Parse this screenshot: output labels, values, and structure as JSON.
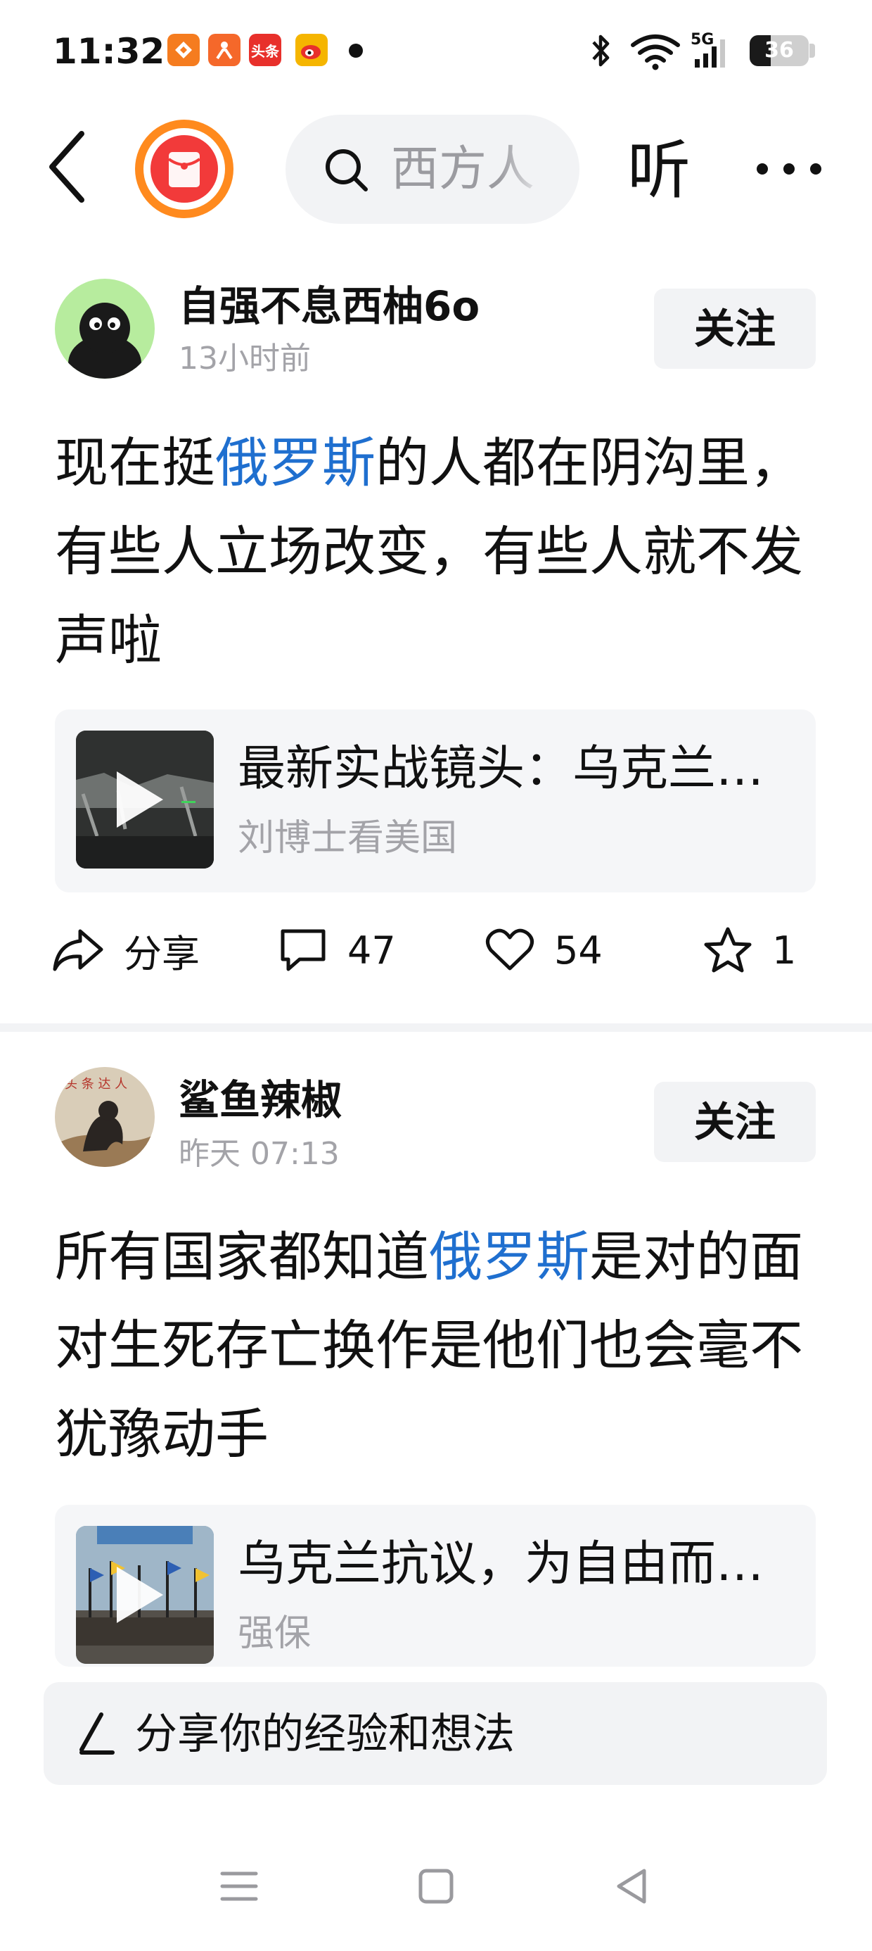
{
  "status_bar": {
    "time": "11:32",
    "app_icons": [
      {
        "name": "app-icon-1",
        "color": "#f57c1f"
      },
      {
        "name": "app-icon-2",
        "color": "#f5682a"
      },
      {
        "name": "toutiao-icon",
        "label": "头条",
        "color": "#e8302b"
      },
      {
        "name": "weibo-icon",
        "color": "#f5b500"
      }
    ],
    "network": "5G",
    "battery": "36",
    "battery_level": 0.36
  },
  "top_bar": {
    "search_placeholder": "西方人",
    "listen_label": "听"
  },
  "posts": [
    {
      "author": "自强不息西柚6o",
      "time": "13小时前",
      "follow_label": "关注",
      "text_before": "现在挺",
      "text_highlight": "俄罗斯",
      "text_after": "的人都在阴沟里，有些人立场改变，有些人就不发声啦",
      "card_title": "最新实战镜头：乌克兰…",
      "card_source": "刘博士看美国",
      "share_label": "分享",
      "comments": "47",
      "likes": "54",
      "favorites": "1"
    },
    {
      "author": "鲨鱼辣椒",
      "time": "昨天  07:13",
      "follow_label": "关注",
      "text_before": "所有国家都知道",
      "text_highlight": "俄罗斯",
      "text_after": "是对的面对生死存亡换作是他们也会毫不犹豫动手",
      "card_title": "乌克兰抗议，为自由而…",
      "card_source": "强保"
    }
  ],
  "compose": {
    "placeholder": "分享你的经验和想法"
  },
  "colors": {
    "highlight": "#1f6fcf",
    "accent_orange": "#ff8a1e",
    "red": "#f23a3a"
  }
}
